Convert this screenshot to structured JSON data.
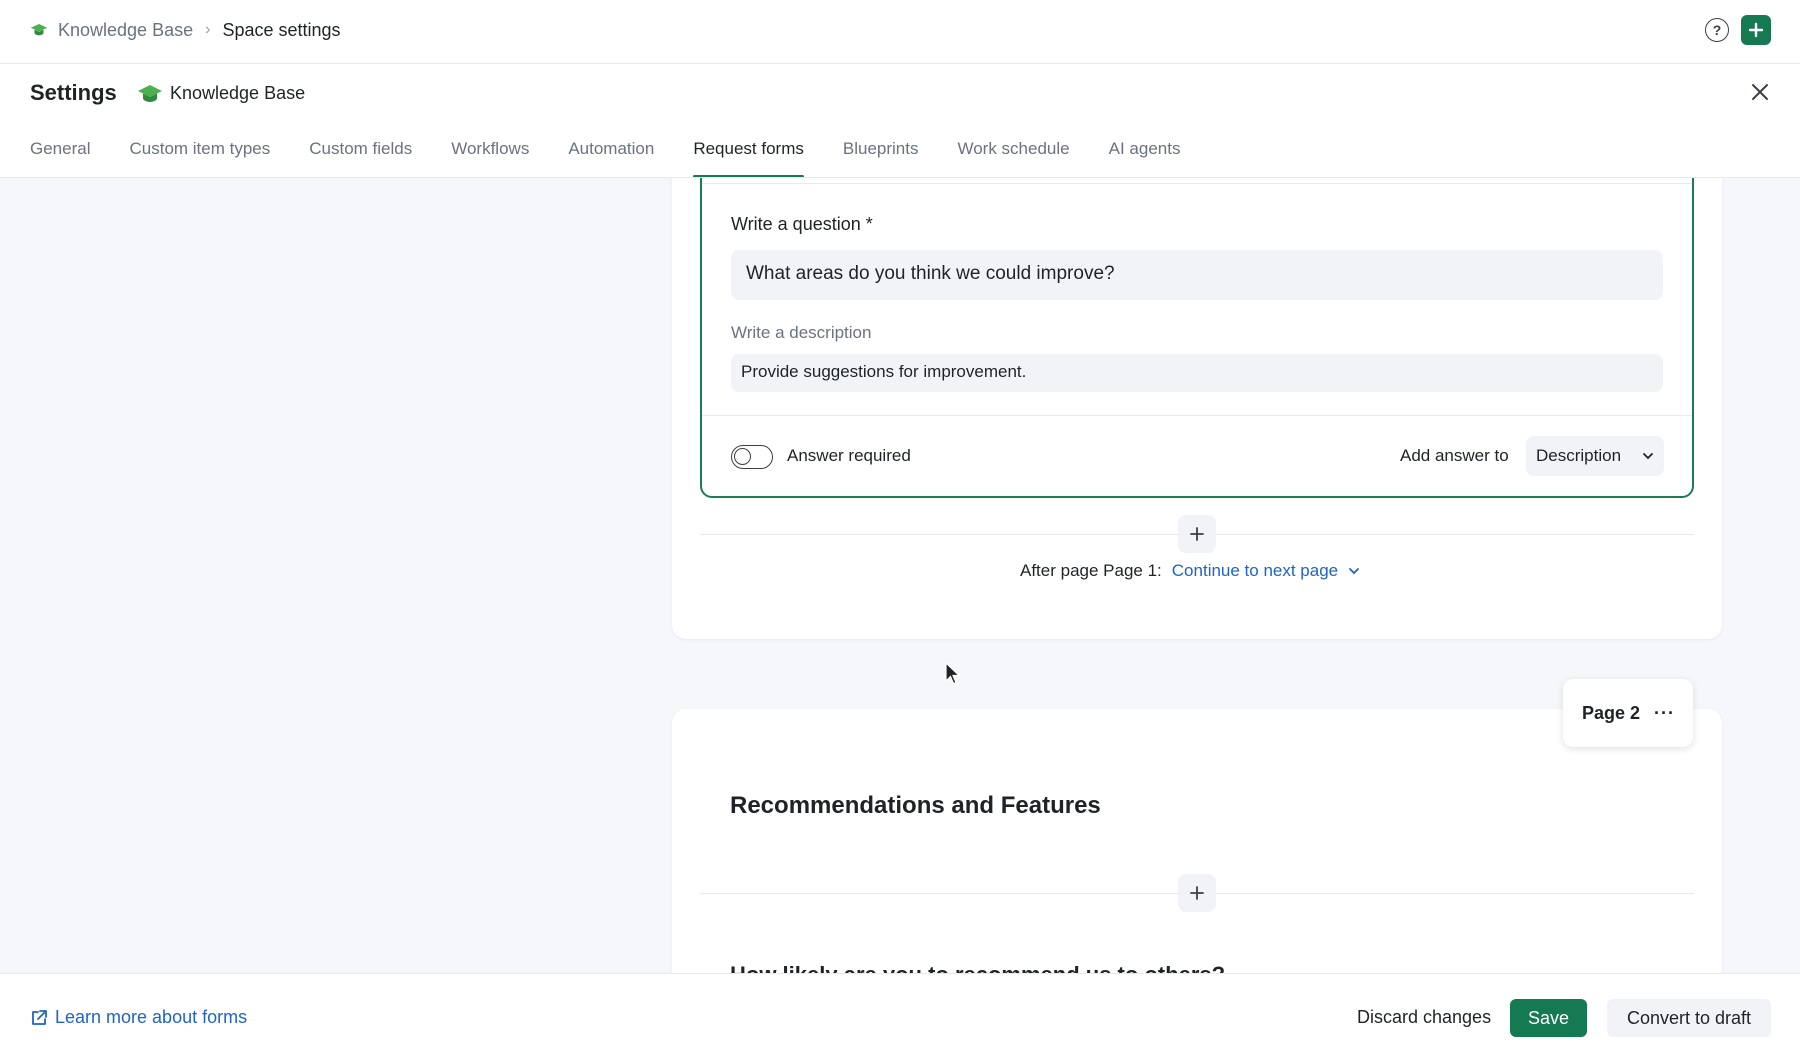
{
  "breadcrumb": {
    "root": "Knowledge Base",
    "current": "Space settings"
  },
  "header": {
    "title": "Settings",
    "space_name": "Knowledge Base",
    "space_icon": "graduation-cap-icon",
    "accent_color": "#157a52"
  },
  "tabs": [
    {
      "label": "General",
      "active": false
    },
    {
      "label": "Custom item types",
      "active": false
    },
    {
      "label": "Custom fields",
      "active": false
    },
    {
      "label": "Workflows",
      "active": false
    },
    {
      "label": "Automation",
      "active": false
    },
    {
      "label": "Request forms",
      "active": true
    },
    {
      "label": "Blueprints",
      "active": false
    },
    {
      "label": "Work schedule",
      "active": false
    },
    {
      "label": "AI agents",
      "active": false
    }
  ],
  "question": {
    "question_label": "Write a question *",
    "question_value": "What areas do you think we could improve?",
    "description_label": "Write a description",
    "description_value": "Provide suggestions for improvement.",
    "required_label": "Answer required",
    "required_on": false,
    "add_answer_label": "Add answer to",
    "add_answer_value": "Description"
  },
  "page_flow": {
    "prefix": "After page Page 1:",
    "action": "Continue to next page"
  },
  "page2": {
    "badge": "Page 2",
    "more": "···",
    "section_title": "Recommendations and Features",
    "next_question_partial": "How likely are you to recommend us to others?"
  },
  "footer": {
    "learn_more": "Learn more about forms",
    "discard": "Discard changes",
    "save": "Save",
    "convert": "Convert to draft"
  }
}
